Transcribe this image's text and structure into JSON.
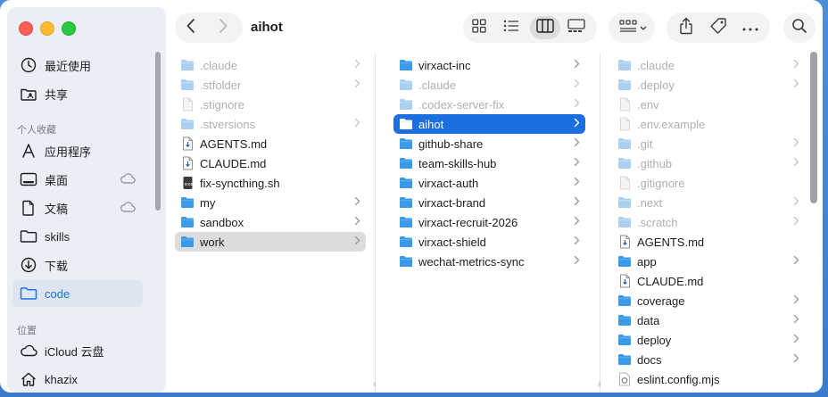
{
  "window": {
    "title": "aihot"
  },
  "sidebar": {
    "favorites": [
      {
        "label": "最近使用",
        "icon": "clock-icon"
      },
      {
        "label": "共享",
        "icon": "shared-folder-icon"
      }
    ],
    "heading_personal": "个人收藏",
    "personal": [
      {
        "label": "应用程序",
        "icon": "applications-icon",
        "cloud": false
      },
      {
        "label": "桌面",
        "icon": "desktop-icon",
        "cloud": true
      },
      {
        "label": "文稿",
        "icon": "document-icon",
        "cloud": true
      },
      {
        "label": "skills",
        "icon": "folder-icon",
        "cloud": false
      },
      {
        "label": "下载",
        "icon": "download-icon",
        "cloud": false
      },
      {
        "label": "code",
        "icon": "folder-icon",
        "cloud": false,
        "selected": true
      }
    ],
    "heading_locations": "位置",
    "locations": [
      {
        "label": "iCloud 云盘",
        "icon": "icloud-icon"
      },
      {
        "label": "khazix",
        "icon": "home-icon"
      }
    ]
  },
  "columns": [
    {
      "items": [
        {
          "name": ".claude",
          "type": "folder",
          "hidden": true,
          "chevron": true
        },
        {
          "name": ".stfolder",
          "type": "folder",
          "hidden": true,
          "chevron": true
        },
        {
          "name": ".stignore",
          "type": "file",
          "hidden": true,
          "chevron": false
        },
        {
          "name": ".stversions",
          "type": "folder",
          "hidden": true,
          "chevron": true
        },
        {
          "name": "AGENTS.md",
          "type": "md",
          "hidden": false,
          "chevron": false
        },
        {
          "name": "CLAUDE.md",
          "type": "md",
          "hidden": false,
          "chevron": false
        },
        {
          "name": "fix-syncthing.sh",
          "type": "script",
          "hidden": false,
          "chevron": false
        },
        {
          "name": "my",
          "type": "folder",
          "hidden": false,
          "chevron": true
        },
        {
          "name": "sandbox",
          "type": "folder",
          "hidden": false,
          "chevron": true
        },
        {
          "name": "work",
          "type": "folder",
          "hidden": false,
          "chevron": true,
          "highlight": true
        }
      ]
    },
    {
      "items": [
        {
          "name": "virxact-inc",
          "type": "folder",
          "hidden": false,
          "chevron": true
        },
        {
          "name": ".claude",
          "type": "folder",
          "hidden": true,
          "chevron": true
        },
        {
          "name": ".codex-server-fix",
          "type": "folder",
          "hidden": true,
          "chevron": true
        },
        {
          "name": "aihot",
          "type": "folder",
          "hidden": false,
          "chevron": true,
          "selected": true
        },
        {
          "name": "github-share",
          "type": "folder",
          "hidden": false,
          "chevron": true
        },
        {
          "name": "team-skills-hub",
          "type": "folder",
          "hidden": false,
          "chevron": true
        },
        {
          "name": "virxact-auth",
          "type": "folder",
          "hidden": false,
          "chevron": true
        },
        {
          "name": "virxact-brand",
          "type": "folder",
          "hidden": false,
          "chevron": true
        },
        {
          "name": "virxact-recruit-2026",
          "type": "folder",
          "hidden": false,
          "chevron": true
        },
        {
          "name": "virxact-shield",
          "type": "folder",
          "hidden": false,
          "chevron": true
        },
        {
          "name": "wechat-metrics-sync",
          "type": "folder",
          "hidden": false,
          "chevron": true
        }
      ]
    },
    {
      "items": [
        {
          "name": ".claude",
          "type": "folder",
          "hidden": true,
          "chevron": true
        },
        {
          "name": ".deploy",
          "type": "folder",
          "hidden": true,
          "chevron": true
        },
        {
          "name": ".env",
          "type": "file",
          "hidden": true,
          "chevron": false
        },
        {
          "name": ".env.example",
          "type": "file",
          "hidden": true,
          "chevron": false
        },
        {
          "name": ".git",
          "type": "folder",
          "hidden": true,
          "chevron": true
        },
        {
          "name": ".github",
          "type": "folder",
          "hidden": true,
          "chevron": true
        },
        {
          "name": ".gitignore",
          "type": "file",
          "hidden": true,
          "chevron": false
        },
        {
          "name": ".next",
          "type": "folder",
          "hidden": true,
          "chevron": true
        },
        {
          "name": ".scratch",
          "type": "folder",
          "hidden": true,
          "chevron": true
        },
        {
          "name": "AGENTS.md",
          "type": "md",
          "hidden": false,
          "chevron": false
        },
        {
          "name": "app",
          "type": "folder",
          "hidden": false,
          "chevron": true
        },
        {
          "name": "CLAUDE.md",
          "type": "md",
          "hidden": false,
          "chevron": false
        },
        {
          "name": "coverage",
          "type": "folder",
          "hidden": false,
          "chevron": true
        },
        {
          "name": "data",
          "type": "folder",
          "hidden": false,
          "chevron": true
        },
        {
          "name": "deploy",
          "type": "folder",
          "hidden": false,
          "chevron": true
        },
        {
          "name": "docs",
          "type": "folder",
          "hidden": false,
          "chevron": true
        },
        {
          "name": "eslint.config.mjs",
          "type": "config",
          "hidden": false,
          "chevron": false
        }
      ]
    }
  ],
  "colors": {
    "accent": "#1b6fe0",
    "folder": "#3a9ae8",
    "folder_hidden": "#a9d0f0"
  }
}
